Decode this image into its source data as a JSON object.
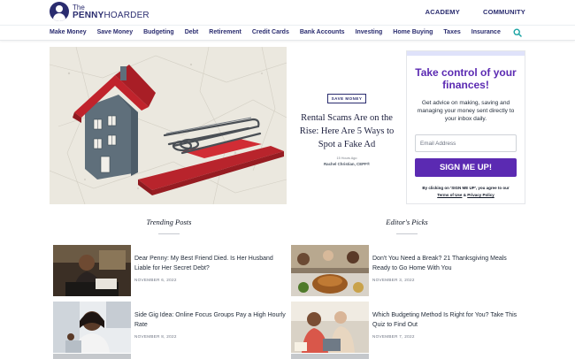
{
  "brand": {
    "logo_the": "The",
    "logo_penny": "PENNY",
    "logo_hoarder": "HOARDER",
    "accent": "#2a2c6f",
    "purple": "#5b2ab2"
  },
  "top_links": [
    "ACADEMY",
    "COMMUNITY"
  ],
  "nav": {
    "items": [
      "Make Money",
      "Save Money",
      "Budgeting",
      "Debt",
      "Retirement",
      "Credit Cards",
      "Bank Accounts",
      "Investing",
      "Home Buying",
      "Taxes",
      "Insurance"
    ],
    "search_icon": "search-icon"
  },
  "hero": {
    "tag": "SAVE MONEY",
    "title": "Rental Scams Are on the Rise: Here Are 5 Ways to Spot a Fake Ad",
    "time": "15 Hours Ago",
    "author": "Rachel Christian, CEPF®"
  },
  "signup": {
    "title": "Take control of your finances!",
    "description": "Get advice on making, saving and managing your money sent directly to your inbox daily.",
    "email_placeholder": "Email Address",
    "button_label": "SIGN ME UP!",
    "legal_prefix": "By clicking on 'SIGN ME UP', you agree to our",
    "terms_label": "Terms of Use",
    "and": "&",
    "privacy_label": "Privacy Policy"
  },
  "trending": {
    "heading": "Trending Posts",
    "posts": [
      {
        "title": "Dear Penny: My Best Friend Died. Is Her Husband Liable for Her Secret Debt?",
        "date": "NOVEMBER 6, 2022"
      },
      {
        "title": "Side Gig Idea: Online Focus Groups Pay a High Hourly Rate",
        "date": "NOVEMBER 8, 2022"
      }
    ]
  },
  "editors": {
    "heading": "Editor's Picks",
    "posts": [
      {
        "title": "Don't You Need a Break? 21 Thanksgiving Meals Ready to Go Home With You",
        "date": "NOVEMBER 3, 2022"
      },
      {
        "title": "Which Budgeting Method Is Right for You? Take This Quiz to Find Out",
        "date": "NOVEMBER 7, 2022"
      }
    ]
  }
}
